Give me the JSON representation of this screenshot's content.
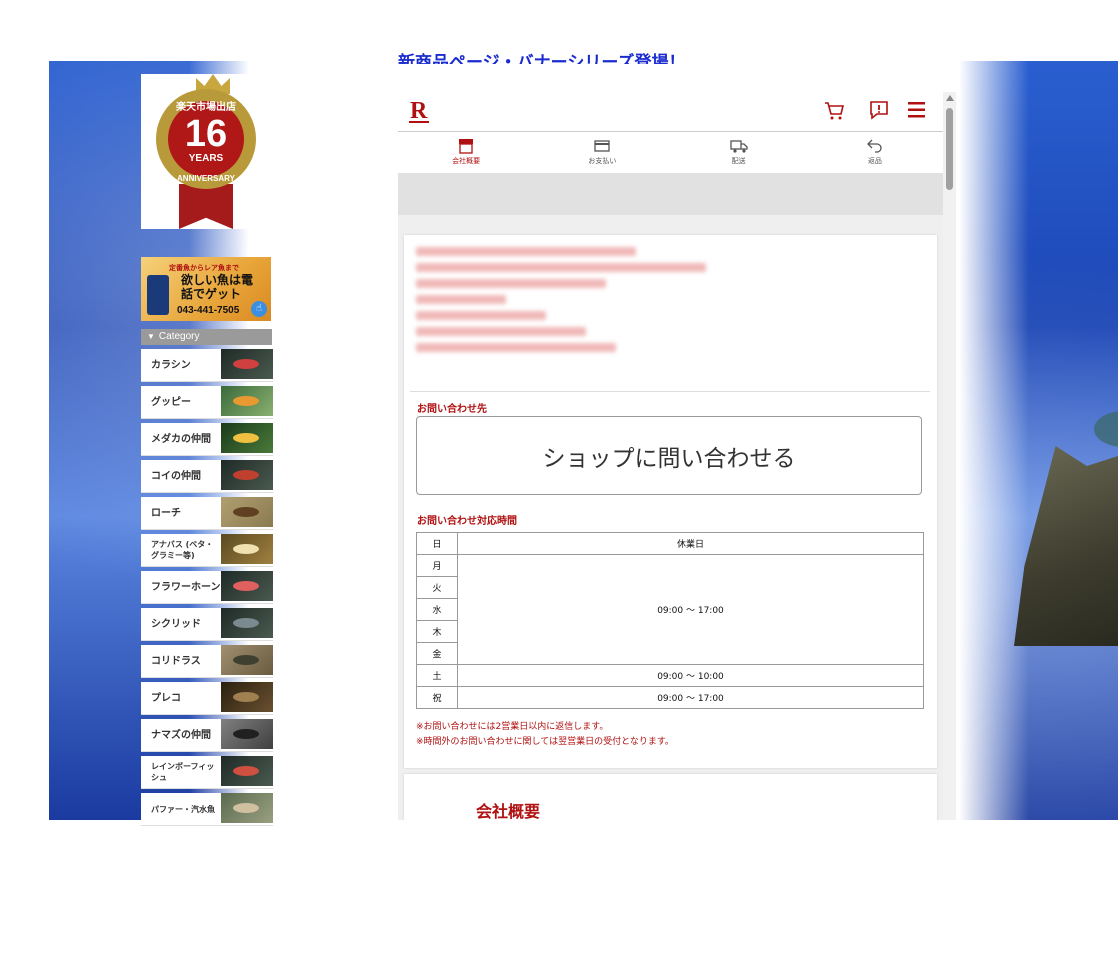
{
  "top_link": "新商品ページ・バナーシリーズ登場！",
  "badge": {
    "top_text": "楽天市場出店",
    "number": "16",
    "years": "YEARS",
    "bottom_text": "ANNIVERSARY"
  },
  "banner": {
    "top_text": "定番魚からレア魚まで",
    "main_text": "欲しい魚は電話でゲット",
    "phone": "043-441-7505"
  },
  "category": {
    "header": "Category",
    "items": [
      {
        "label": "カラシン"
      },
      {
        "label": "グッピー"
      },
      {
        "label": "メダカの仲間"
      },
      {
        "label": "コイの仲間"
      },
      {
        "label": "ローチ"
      },
      {
        "label": "アナバス (ベタ・グラミー等)"
      },
      {
        "label": "フラワーホーン"
      },
      {
        "label": "シクリッド"
      },
      {
        "label": "コリドラス"
      },
      {
        "label": "プレコ"
      },
      {
        "label": "ナマズの仲間"
      },
      {
        "label": "レインボーフィッシュ"
      },
      {
        "label": "パファー・汽水魚"
      }
    ]
  },
  "header_icons": [
    "rakuten-logo-icon",
    "cart-icon",
    "inquiry-icon",
    "menu-icon"
  ],
  "tabs": [
    {
      "label": "会社概要",
      "icon": "shop-icon",
      "active": true
    },
    {
      "label": "お支払い",
      "icon": "card-icon",
      "active": false
    },
    {
      "label": "配送",
      "icon": "truck-icon",
      "active": false
    },
    {
      "label": "返品",
      "icon": "return-icon",
      "active": false
    }
  ],
  "contact": {
    "section_title": "お問い合わせ先",
    "button": "ショップに問い合わせる",
    "hours_title": "お問い合わせ対応時間",
    "table": {
      "col_day": "日",
      "col_holiday": "休業日",
      "weekdays": [
        "月",
        "火",
        "水",
        "木",
        "金"
      ],
      "weekday_hours": "09:00 ～ 17:00",
      "sat": "土",
      "sat_hours": "09:00 ～ 10:00",
      "hol": "祝",
      "hol_hours": "09:00 ～ 17:00"
    },
    "note1": "※お問い合わせには2営業日以内に返信します。",
    "note2": "※時間外のお問い合わせに関しては翌営業日の受付となります。"
  },
  "company": {
    "title": "会社概要"
  },
  "colors": {
    "brand": "#b01010",
    "link": "#1a2bd0"
  }
}
